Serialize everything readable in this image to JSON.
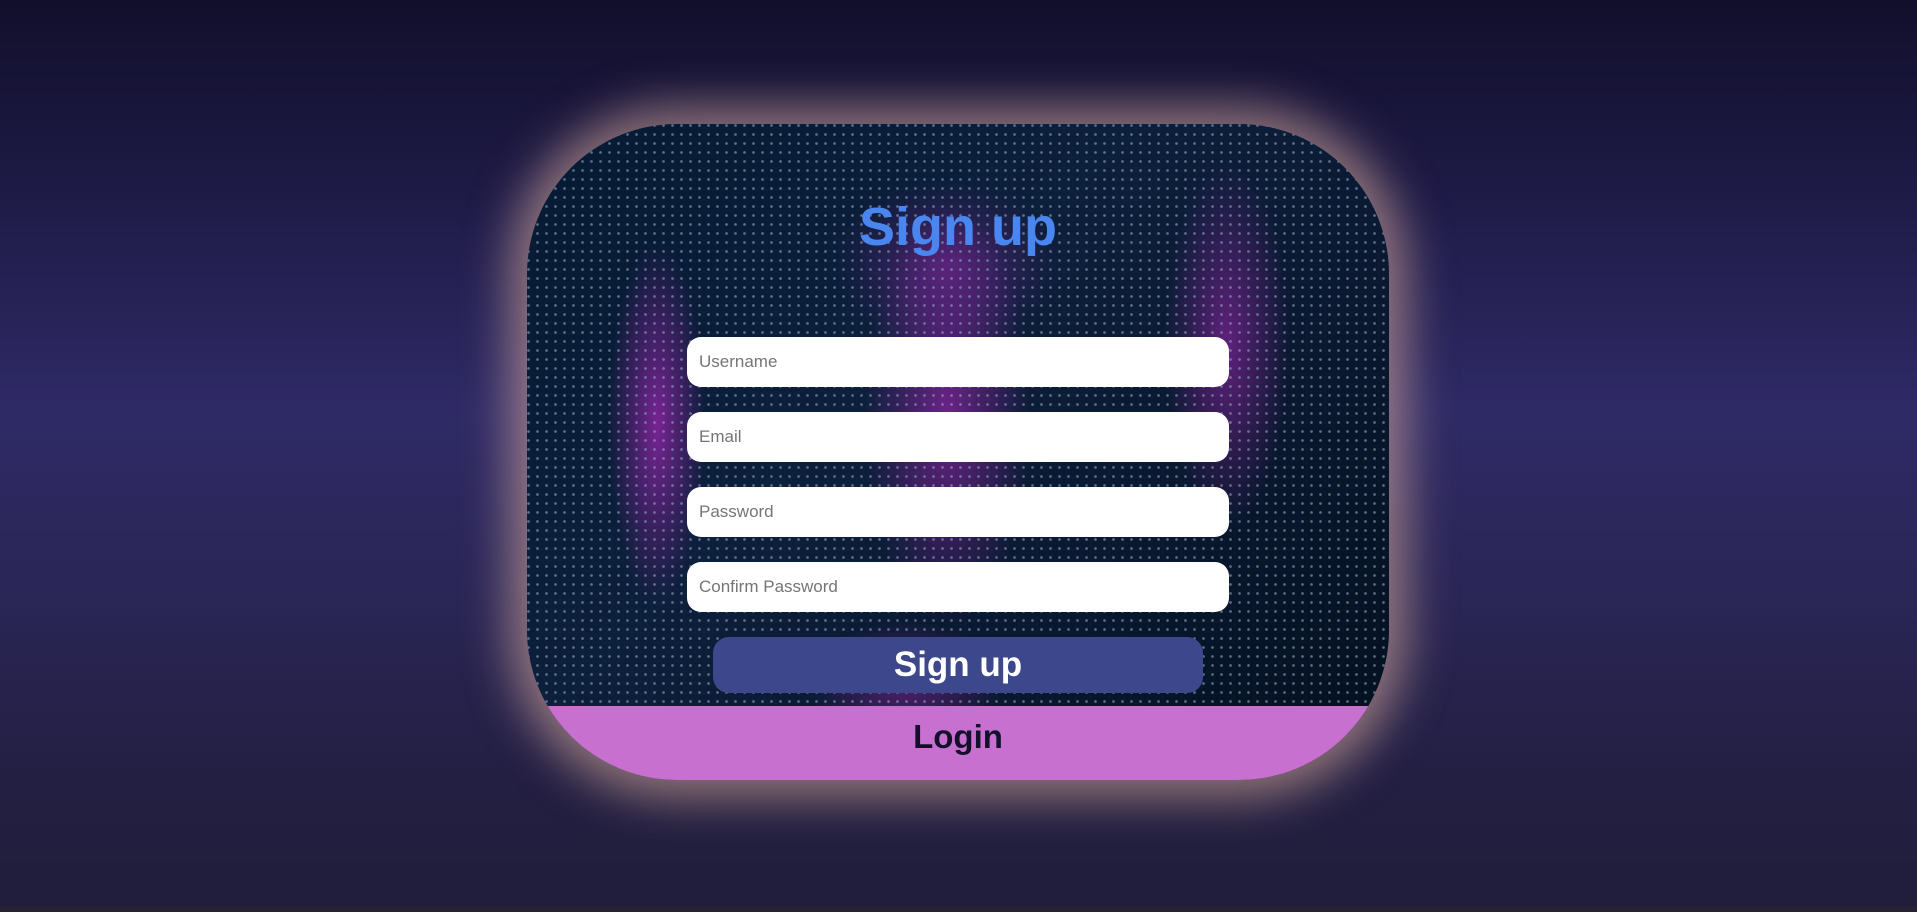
{
  "form": {
    "title": "Sign up",
    "fields": [
      {
        "placeholder": "Username",
        "value": ""
      },
      {
        "placeholder": "Email",
        "value": ""
      },
      {
        "placeholder": "Password",
        "value": ""
      },
      {
        "placeholder": "Confirm Password",
        "value": ""
      }
    ],
    "submit_label": "Sign up",
    "login_label": "Login"
  },
  "colors": {
    "title": "#4a86f0",
    "submit_button": "#3c478c",
    "login_strip": "#c870d0",
    "glow": "#ebb9a5"
  }
}
